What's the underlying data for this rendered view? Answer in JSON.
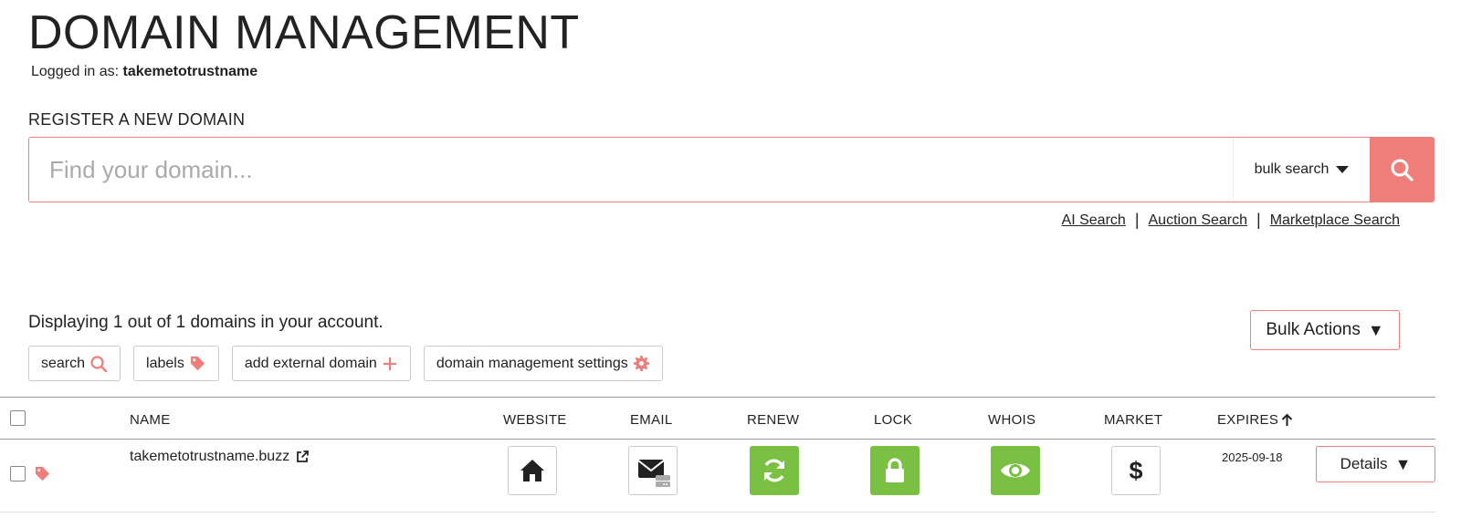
{
  "header": {
    "title": "DOMAIN MANAGEMENT",
    "logged_in_prefix": "Logged in as:",
    "username": "takemetotrustname"
  },
  "register": {
    "title": "REGISTER A NEW DOMAIN",
    "placeholder": "Find your domain...",
    "bulk_label": "bulk search",
    "links": [
      "AI Search",
      "Auction Search",
      "Marketplace Search"
    ]
  },
  "summary": {
    "text": "Displaying 1 out of 1 domains in your account.",
    "bulk_actions_label": "Bulk Actions"
  },
  "tools": {
    "search": "search",
    "labels": "labels",
    "add_external": "add external domain",
    "settings": "domain management settings"
  },
  "table": {
    "columns": {
      "name": "NAME",
      "website": "WEBSITE",
      "email": "EMAIL",
      "renew": "RENEW",
      "lock": "LOCK",
      "whois": "WHOIS",
      "market": "MARKET",
      "expires": "EXPIRES"
    },
    "rows": [
      {
        "domain": "takemetotrustname.buzz",
        "expires": "2025-09-18",
        "details_label": "Details"
      }
    ]
  },
  "colors": {
    "accent": "#ef7d7a",
    "green": "#7ac143"
  }
}
